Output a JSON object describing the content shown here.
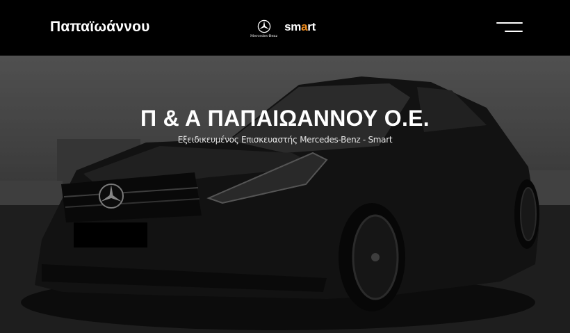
{
  "header": {
    "brand_name": "Παπαϊωάννου",
    "partner_logos": {
      "mercedes_label": "Mercedes-Benz",
      "smart_label_main": "sm",
      "smart_label_accent": "a",
      "smart_label_tail": "rt"
    },
    "menu_icon": "hamburger-icon"
  },
  "hero": {
    "title": "Π & Α ΠΑΠΑΙΩΑΝΝΟΥ Ο.Ε.",
    "subtitle": "Εξειδικευμένος Επισκευαστής Mercedes-Benz - Smart",
    "background_image": "black Mercedes-Benz sedan"
  },
  "colors": {
    "header_bg": "#000000",
    "text": "#ffffff",
    "smart_accent": "#f08c1e"
  }
}
